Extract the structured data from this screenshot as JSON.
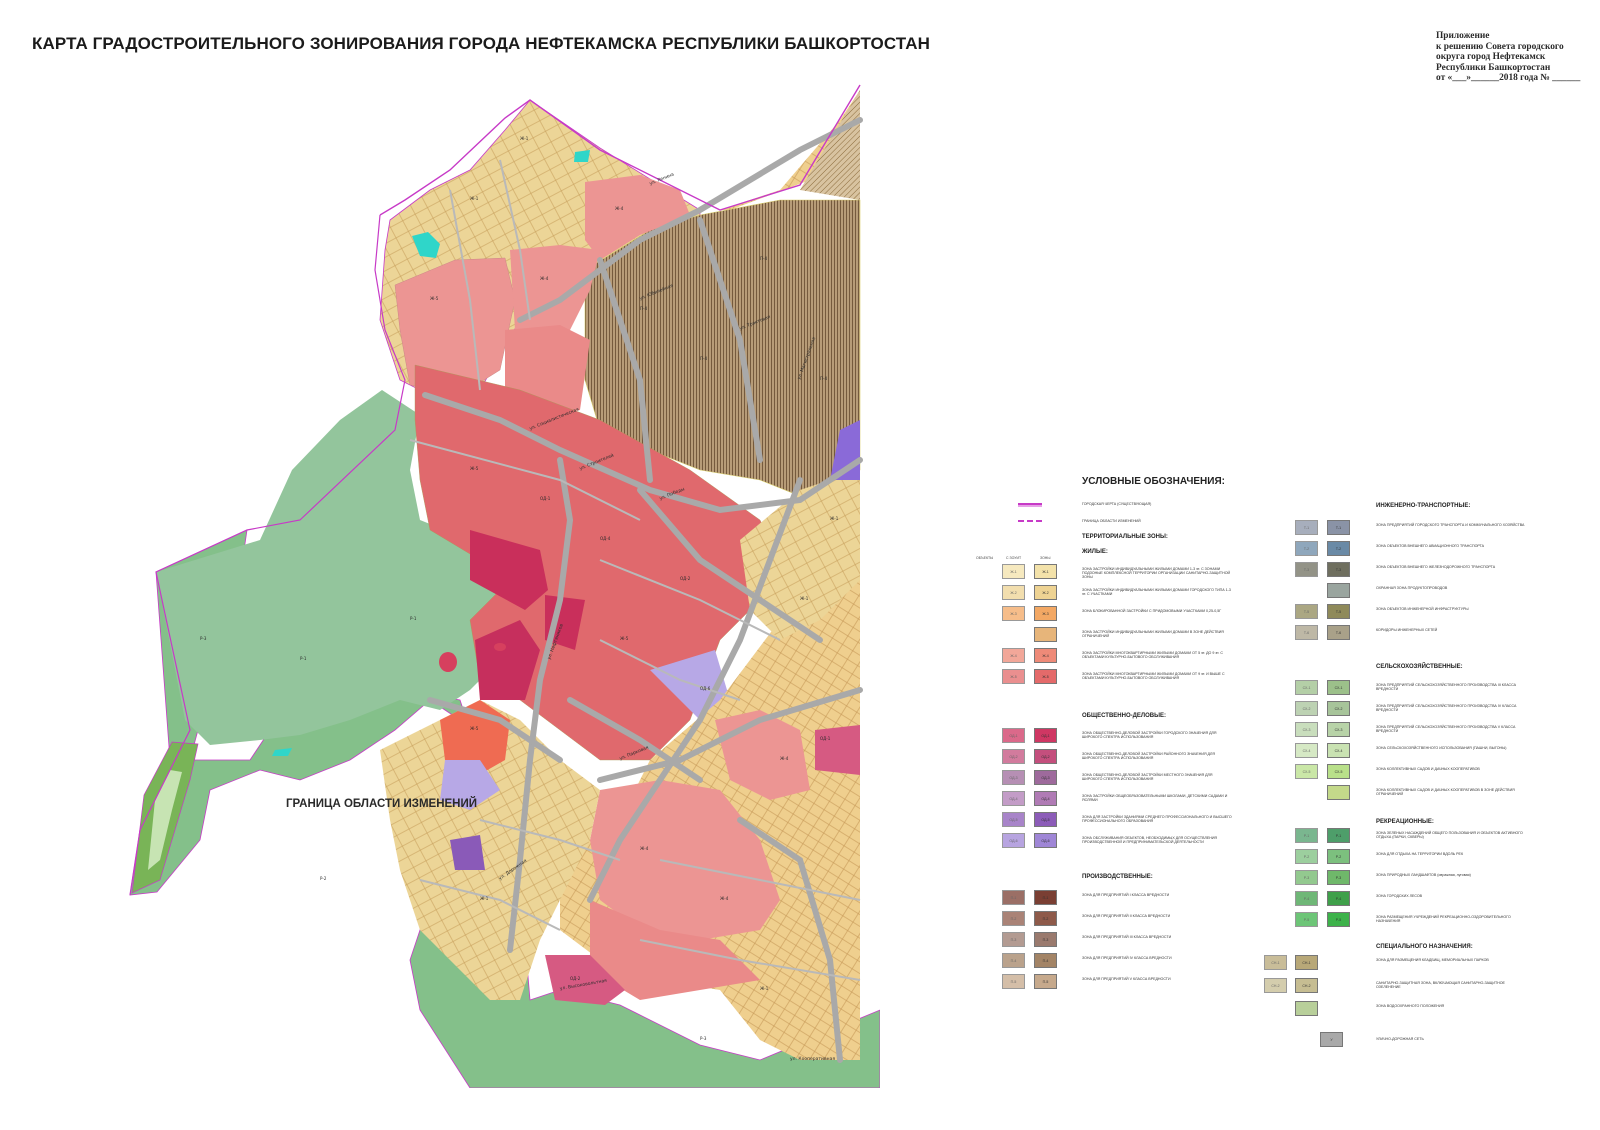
{
  "title": "КАРТА ГРАДОСТРОИТЕЛЬНОГО ЗОНИРОВАНИЯ ГОРОДА НЕФТЕКАМСКА РЕСПУБЛИКИ БАШКОРТОСТАН",
  "appendix": {
    "lines": [
      "Приложение",
      "к решению Совета городского",
      "округа город Нефтекамск",
      "Республики Башкортостан",
      "от «___»______2018  года № ______"
    ]
  },
  "map": {
    "boundary_label": "ГРАНИЦА ОБЛАСТИ ИЗМЕНЕНИЙ",
    "colors": {
      "greenery": "#7fbf85",
      "green_pale": "#93c59c",
      "residential_low": "#ecd597",
      "residential_mid": "#f0c98f",
      "residential_high": "#e8706f",
      "public": "#cf3f64",
      "industrial": "#8a6c4f",
      "street": "#a9a9a9",
      "boundary": "#c73ac7",
      "special": "#b6a6e8"
    },
    "streets": [
      "ул. Ленина",
      "ул. Строителей",
      "ул. Победы",
      "ул. Нефтяников",
      "ул. Парковая",
      "ул. Социалистическая",
      "ул. Трактовая",
      "ул. Магистральная",
      "ул. Высоковольтная",
      "ул. Юбилейная",
      "ул. Дорожная",
      "ул. Кооперативная"
    ],
    "zone_codes": [
      "Ж-1",
      "Ж-2",
      "Ж-3",
      "Ж-4",
      "Ж-5",
      "ОД-1",
      "ОД-2",
      "ОД-3",
      "ОД-4",
      "ОД-5",
      "ОД-6",
      "П-1",
      "П-2",
      "П-3",
      "П-4",
      "П-5",
      "Р-1",
      "Р-2",
      "Р-3",
      "Р-4",
      "Р-5",
      "Т-1",
      "Т-2",
      "Т-3",
      "Т-5",
      "Т-6",
      "СХ-1",
      "СХ-2",
      "СН-1",
      "СН-2"
    ]
  },
  "legend": {
    "title": "УСЛОВНЫЕ ОБОЗНАЧЕНИЯ:",
    "lines": [
      {
        "label": "ГОРОДСКАЯ ЧЕРТА (СУЩЕСТВУЮЩАЯ)",
        "color": "#c73ac7"
      },
      {
        "label": "ГРАНИЦА ОБЛАСТИ ИЗМЕНЕНИЙ",
        "color": "#c73ac7"
      }
    ],
    "territorial_heading": "ТЕРРИТОРИАЛЬНЫЕ ЗОНЫ:",
    "column_headers": [
      "ОБЪЕКТЫ",
      "С ЗОУИТ",
      "ЗОНЫ"
    ],
    "residential": {
      "heading": "ЖИЛЫЕ:",
      "items": [
        {
          "label": "ЗОНА ЗАСТРОЙКИ ИНДИВИДУАЛЬНЫМИ ЖИЛЫМИ ДОМАМИ 1-3 эт. С ЗОНАМИ ПОДЗОНЫЕ КОМПЛЕКСНОЙ ТЕРРИТОРИИ ОРГАНИЗАЦИИ САНИТАРНО-ЗАЩИТНОЙ ЗОНЫ",
          "code": "Ж-1",
          "color": "#f3e2aa"
        },
        {
          "label": "ЗОНА ЗАСТРОЙКИ ИНДИВИДУАЛЬНЫМИ ЖИЛЫМИ ДОМАМИ ГОРОДСКОГО ТИПА 1-3 эт. С УЧАСТКАМИ",
          "code": "Ж-2",
          "color": "#eed393"
        },
        {
          "label": "ЗОНА БЛОКИРОВАННОЙ ЗАСТРОЙКИ С ПРИДОМОВЫМИ УЧАСТКАМИ 0,25-0,5Г",
          "code": "Ж-3",
          "color": "#f3a864"
        },
        {
          "label": "ЗОНА ЗАСТРОЙКИ ИНДИВИДУАЛЬНЫМИ ЖИЛЫМИ ДОМАМИ В ЗОНЕ ДЕЙСТВИЯ ОГРАНИЧЕНИЙ",
          "code": "",
          "color": "#e7b57a"
        },
        {
          "label": "ЗОНА ЗАСТРОЙКИ МНОГОКВАРТИРНЫМИ ЖИЛЫМИ ДОМАМИ ОТ 5 эт. ДО 9 эт. С ОБЪЕКТАМИ КУЛЬТУРНО-БЫТОВОГО ОБСЛУЖИВАНИЯ",
          "code": "Ж-4",
          "color": "#ee8a78"
        },
        {
          "label": "ЗОНА ЗАСТРОЙКИ МНОГОКВАРТИРНЫМИ ЖИЛЫМИ ДОМАМИ ОТ 9 эт. И ВЫШЕ С ОБЪЕКТАМИ КУЛЬТУРНО-БЫТОВОГО ОБСЛУЖИВАНИЯ",
          "code": "Ж-5",
          "color": "#e46a6a"
        }
      ]
    },
    "public": {
      "heading": "ОБЩЕСТВЕННО-ДЕЛОВЫЕ:",
      "items": [
        {
          "label": "ЗОНА ОБЩЕСТВЕННО-ДЕЛОВОЙ ЗАСТРОЙКИ ГОРОДСКОГО ЗНАЧЕНИЯ ДЛЯ ШИРОКОГО СПЕКТРА ИСПОЛЬЗОВАНИЯ",
          "code": "ОД-1",
          "color": "#cf3763"
        },
        {
          "label": "ЗОНА ОБЩЕСТВЕННО-ДЕЛОВОЙ ЗАСТРОЙКИ РАЙОННОГО ЗНАЧЕНИЯ ДЛЯ ШИРОКОГО СПЕКТРА ИСПОЛЬЗОВАНИЯ",
          "code": "ОД-2",
          "color": "#c44f7d"
        },
        {
          "label": "ЗОНА ОБЩЕСТВЕННО-ДЕЛОВОЙ ЗАСТРОЙКИ МЕСТНОГО ЗНАЧЕНИЯ ДЛЯ ШИРОКОГО СПЕКТРА ИСПОЛЬЗОВАНИЯ",
          "code": "ОД-3",
          "color": "#9e6a9c"
        },
        {
          "label": "ЗОНА ЗАСТРОЙКИ ОБЩЕОБРАЗОВАТЕЛЬНЫМИ ШКОЛАМИ, ДЕТСКИМИ САДАМИ И ЯСЛЯМИ",
          "code": "ОД-4",
          "color": "#b07bb5"
        },
        {
          "label": "ЗОНА ДЛЯ ЗАСТРОЙКИ ЗДАНИЯМИ СРЕДНЕГО ПРОФЕССИОНАЛЬНОГО И ВЫСШЕГО ПРОФЕССИОНАЛЬНОГО ОБРАЗОВАНИЯ",
          "code": "ОД-5",
          "color": "#8c5cb8"
        },
        {
          "label": "ЗОНА ОБСЛУЖИВАНИЯ ОБЪЕКТОВ, НЕОБХОДИМЫХ ДЛЯ ОСУЩЕСТВЛЕНИЯ ПРОИЗВОДСТВЕННОЙ И ПРЕДПРИНИМАТЕЛЬСКОЙ ДЕЯТЕЛЬНОСТИ",
          "code": "ОД-6",
          "color": "#9f86d6"
        }
      ]
    },
    "industrial": {
      "heading": "ПРОИЗВОДСТВЕННЫЕ:",
      "items": [
        {
          "label": "ЗОНА ДЛЯ ПРЕДПРИЯТИЙ I КЛАССА ВРЕДНОСТИ",
          "code": "П-1",
          "color": "#7a3f33"
        },
        {
          "label": "ЗОНА ДЛЯ ПРЕДПРИЯТИЙ II КЛАССА ВРЕДНОСТИ",
          "code": "П-2",
          "color": "#8e5a4a"
        },
        {
          "label": "ЗОНА ДЛЯ ПРЕДПРИЯТИЙ III КЛАССА ВРЕДНОСТИ",
          "code": "П-3",
          "color": "#9a7a6e"
        },
        {
          "label": "ЗОНА ДЛЯ ПРЕДПРИЯТИЙ IV КЛАССА ВРЕДНОСТИ",
          "code": "П-4",
          "color": "#a38466"
        },
        {
          "label": "ЗОНА ДЛЯ ПРЕДПРИЯТИЙ V КЛАССА ВРЕДНОСТИ",
          "code": "П-5",
          "color": "#c6a98c"
        }
      ]
    },
    "transport": {
      "heading": "ИНЖЕНЕРНО-ТРАНСПОРТНЫЕ:",
      "items": [
        {
          "label": "ЗОНА ПРЕДПРИЯТИЙ ГОРОДСКОГО ТРАНСПОРТА И КОММУНАЛЬНОГО ХОЗЯЙСТВА",
          "code": "Т-1",
          "color": "#8a93a6"
        },
        {
          "label": "ЗОНА ОБЪЕКТОВ ВНЕШНЕГО АВИАЦИОННОГО ТРАНСПОРТА",
          "code": "Т-2",
          "color": "#6a8aa6"
        },
        {
          "label": "ЗОНА ОБЪЕКТОВ ВНЕШНЕГО ЖЕЛЕЗНОДОРОЖНОГО ТРАНСПОРТА",
          "code": "Т-3",
          "color": "#6f6f5f"
        },
        {
          "label": "ОХРАННАЯ ЗОНА ПРОДУКТОПРОВОДОВ",
          "code": "",
          "color": "#9aa59f"
        },
        {
          "label": "ЗОНА ОБЪЕКТОВ ИНЖЕНЕРНОЙ ИНФРАСТРУКТУРЫ",
          "code": "Т-5",
          "color": "#8f8a5a"
        },
        {
          "label": "КОРИДОРЫ ИНЖЕНЕРНЫХ СЕТЕЙ",
          "code": "Т-6",
          "color": "#a9a189"
        }
      ]
    },
    "agricultural": {
      "heading": "СЕЛЬСКОХОЗЯЙСТВЕННЫЕ:",
      "items": [
        {
          "label": "ЗОНА ПРЕДПРИЯТИЙ СЕЛЬСКОХОЗЯЙСТВЕННОГО ПРОИЗВОДСТВА III КЛАССА ВРЕДНОСТИ",
          "code": "СХ-1",
          "color": "#9cc08a"
        },
        {
          "label": "ЗОНА ПРЕДПРИЯТИЙ СЕЛЬСКОХОЗЯЙСТВЕННОГО ПРОИЗВОДСТВА IV КЛАССА ВРЕДНОСТИ",
          "code": "СХ-2",
          "color": "#a7c49a"
        },
        {
          "label": "ЗОНА ПРЕДПРИЯТИЙ СЕЛЬСКОХОЗЯЙСТВЕННОГО ПРОИЗВОДСТВА V КЛАССА ВРЕДНОСТИ",
          "code": "СХ-3",
          "color": "#b8d3a8"
        },
        {
          "label": "ЗОНА СЕЛЬСКОХОЗЯЙСТВЕННОГО ИСПОЛЬЗОВАНИЯ (ПАШНИ, ВЫГОНЫ)",
          "code": "СХ-4",
          "color": "#c9e2b2"
        },
        {
          "label": "ЗОНА КОЛЛЕКТИВНЫХ САДОВ И ДАЧНЫХ КООПЕРАТИВОВ",
          "code": "СХ-5",
          "color": "#b9e08a"
        },
        {
          "label": "ЗОНА КОЛЛЕКТИВНЫХ САДОВ И ДАЧНЫХ КООПЕРАТИВОВ В ЗОНЕ ДЕЙСТВИЯ ОГРАНИЧЕНИЙ",
          "code": "",
          "color": "#c4d98a"
        }
      ]
    },
    "recreational": {
      "heading": "РЕКРЕАЦИОННЫЕ:",
      "items": [
        {
          "label": "ЗОНА ЗЕЛЕНЫХ НАСАЖДЕНИЙ ОБЩЕГО ПОЛЬЗОВАНИЯ И ОБЪЕКТОВ АКТИВНОГО ОТДЫХА (ПАРКИ, СКВЕРЫ)",
          "code": "Р-1",
          "color": "#4e9e6a"
        },
        {
          "label": "ЗОНА ДЛЯ ОТДЫХА НА ТЕРРИТОРИИ ВДОЛЬ РЕК",
          "code": "Р-2",
          "color": "#7cc07e"
        },
        {
          "label": "ЗОНА ПРИРОДНЫХ ЛАНДШАФТОВ (овражная, луговая)",
          "code": "Р-3",
          "color": "#6fb86a"
        },
        {
          "label": "ЗОНА ГОРОДСКИХ ЛЕСОВ",
          "code": "Р-4",
          "color": "#3fa04a"
        },
        {
          "label": "ЗОНА РАЗМЕЩЕНИЯ УЧРЕЖДЕНИЙ РЕКРЕАЦИОННО-ОЗДОРОВИТЕЛЬНОГО НАЗНАЧЕНИЯ",
          "code": "Р-5",
          "color": "#3db24a"
        }
      ]
    },
    "special": {
      "heading": "СПЕЦИАЛЬНОГО НАЗНАЧЕНИЯ:",
      "items": [
        {
          "label": "ЗОНА ДЛЯ РАЗМЕЩЕНИЯ КЛАДБИЩ, МЕМОРИАЛЬНЫХ ПАРКОВ",
          "code": "СН-1",
          "color": "#b8a878"
        },
        {
          "label": "САНИТАРНО-ЗАЩИТНАЯ ЗОНА, ВКЛЮЧАЮЩАЯ САНИТАРНО-ЗАЩИТНОЕ ОЗЕЛЕНЕНИЕ",
          "code": "СН-2",
          "color": "#c6bd92"
        },
        {
          "label": "ЗОНА ВОДООХРАННОГО ПОЛОЖЕНИЯ",
          "code": "",
          "color": "#b8cf9a"
        }
      ]
    },
    "road": {
      "label": "УЛИЧНО-ДОРОЖНАЯ СЕТЬ",
      "color": "#a9a9a9"
    }
  }
}
